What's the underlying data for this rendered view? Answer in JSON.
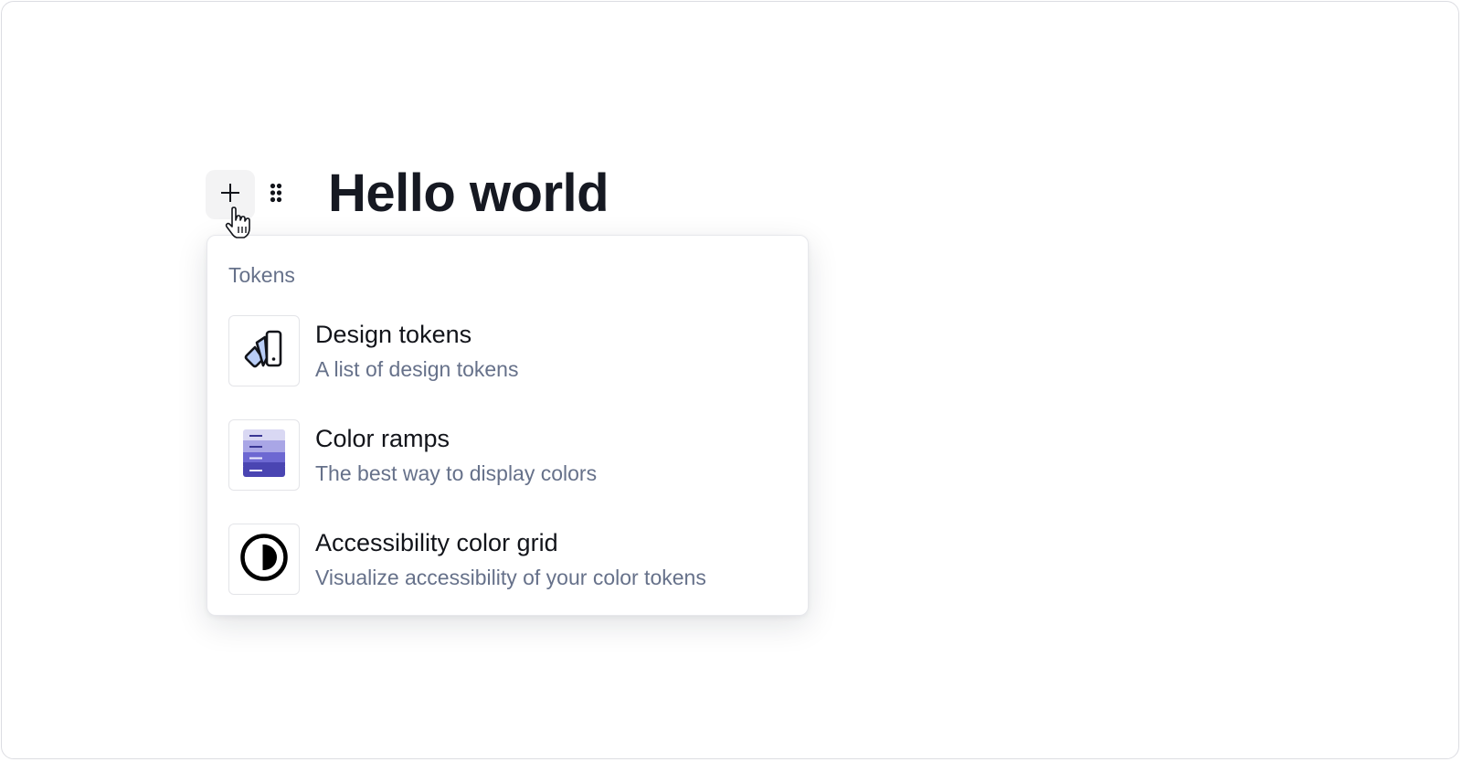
{
  "editor": {
    "heading": "Hello world",
    "add_block_icon": "plus-icon",
    "drag_handle_icon": "drag-handle-icon",
    "cursor_icon": "pointer-hand-icon"
  },
  "menu": {
    "section_label": "Tokens",
    "items": [
      {
        "title": "Design tokens",
        "description": "A list of design tokens",
        "icon": "swatches-icon"
      },
      {
        "title": "Color ramps",
        "description": "The best way to display colors",
        "icon": "color-ramp-icon"
      },
      {
        "title": "Accessibility color grid",
        "description": "Visualize accessibility of your color tokens",
        "icon": "contrast-icon"
      }
    ]
  },
  "colors": {
    "ramp_1": "#d9d8f3",
    "ramp_2": "#a9a6e6",
    "ramp_3": "#6d68d2",
    "ramp_4": "#4a45b2",
    "swatch_fill": "#b9cdf6",
    "text_primary": "#12141a",
    "text_secondary": "#66718a"
  }
}
